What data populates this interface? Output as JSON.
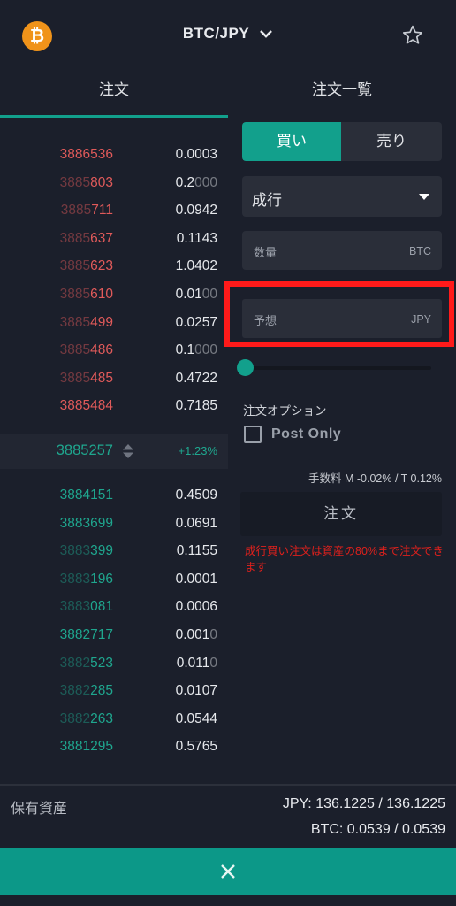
{
  "header": {
    "coin_symbol": "₿",
    "coin_icon": "bitcoin-icon",
    "pair": "BTC/JPY",
    "pair_dropdown_icon": "chevron-down-icon",
    "favorite_icon": "star-outline-icon"
  },
  "tabs": [
    {
      "label": "注文",
      "active": true
    },
    {
      "label": "注文一覧",
      "active": false
    }
  ],
  "orderbook": {
    "asks": [
      {
        "price": "3886536",
        "dim_prefix": "",
        "bright": "3886536",
        "qty_bright": "0.0003",
        "qty_dim": ""
      },
      {
        "price": "3885803",
        "dim_prefix": "3885",
        "bright": "803",
        "qty_bright": "0.2",
        "qty_dim": "000"
      },
      {
        "price": "3885711",
        "dim_prefix": "3885",
        "bright": "711",
        "qty_bright": "0.0942",
        "qty_dim": ""
      },
      {
        "price": "3885637",
        "dim_prefix": "3885",
        "bright": "637",
        "qty_bright": "0.1143",
        "qty_dim": ""
      },
      {
        "price": "3885623",
        "dim_prefix": "3885",
        "bright": "623",
        "qty_bright": "1.0402",
        "qty_dim": ""
      },
      {
        "price": "3885610",
        "dim_prefix": "3885",
        "bright": "610",
        "qty_bright": "0.01",
        "qty_dim": "00"
      },
      {
        "price": "3885499",
        "dim_prefix": "3885",
        "bright": "499",
        "qty_bright": "0.0257",
        "qty_dim": ""
      },
      {
        "price": "3885486",
        "dim_prefix": "3885",
        "bright": "486",
        "qty_bright": "0.1",
        "qty_dim": "000"
      },
      {
        "price": "3885485",
        "dim_prefix": "3885",
        "bright": "485",
        "qty_bright": "0.4722",
        "qty_dim": ""
      },
      {
        "price": "3885484",
        "dim_prefix": "",
        "bright": "3885484",
        "qty_bright": "0.7185",
        "qty_dim": ""
      }
    ],
    "mid": {
      "price": "3885257",
      "arrows_icon": "sort-updown-icon",
      "change": "+1.23%"
    },
    "bids": [
      {
        "price": "3884151",
        "dim_prefix": "",
        "bright": "3884151",
        "qty_bright": "0.4509",
        "qty_dim": ""
      },
      {
        "price": "3883699",
        "dim_prefix": "",
        "bright": "3883699",
        "qty_bright": "0.0691",
        "qty_dim": ""
      },
      {
        "price": "3883399",
        "dim_prefix": "3883",
        "bright": "399",
        "qty_bright": "0.1155",
        "qty_dim": ""
      },
      {
        "price": "3883196",
        "dim_prefix": "3883",
        "bright": "196",
        "qty_bright": "0.0001",
        "qty_dim": ""
      },
      {
        "price": "3883081",
        "dim_prefix": "3883",
        "bright": "081",
        "qty_bright": "0.0006",
        "qty_dim": ""
      },
      {
        "price": "3882717",
        "dim_prefix": "",
        "bright": "3882717",
        "qty_bright": "0.001",
        "qty_dim": "0"
      },
      {
        "price": "3882523",
        "dim_prefix": "3882",
        "bright": "523",
        "qty_bright": "0.011",
        "qty_dim": "0"
      },
      {
        "price": "3882285",
        "dim_prefix": "3882",
        "bright": "285",
        "qty_bright": "0.0107",
        "qty_dim": ""
      },
      {
        "price": "3882263",
        "dim_prefix": "3882",
        "bright": "263",
        "qty_bright": "0.0544",
        "qty_dim": ""
      },
      {
        "price": "3881295",
        "dim_prefix": "",
        "bright": "3881295",
        "qty_bright": "0.5765",
        "qty_dim": ""
      }
    ]
  },
  "order_form": {
    "side_buy": "買い",
    "side_sell": "売り",
    "order_type": "成行",
    "order_type_icon": "caret-down-icon",
    "quantity_label": "数量",
    "quantity_unit": "BTC",
    "estimate_label": "予想",
    "estimate_unit": "JPY",
    "slider_value_percent": 0,
    "options_title": "注文オプション",
    "post_only_label": "Post Only",
    "post_only_checked": false,
    "fee_text": "手数料 M -0.02% / T 0.12%",
    "submit_label": "注文",
    "warning": "成行買い注文は資産の80%まで注文できます"
  },
  "assets": {
    "label": "保有資産",
    "jpy": "JPY: 136.1225 / 136.1225",
    "btc": "BTC: 0.0539 / 0.0539"
  },
  "close_icon": "close-icon",
  "colors": {
    "accent": "#12a08c",
    "ask": "#e05a5a",
    "bid": "#1fa68e",
    "background": "#1b1f2b",
    "highlight": "#ff1a1a",
    "warning": "#e0201c"
  }
}
